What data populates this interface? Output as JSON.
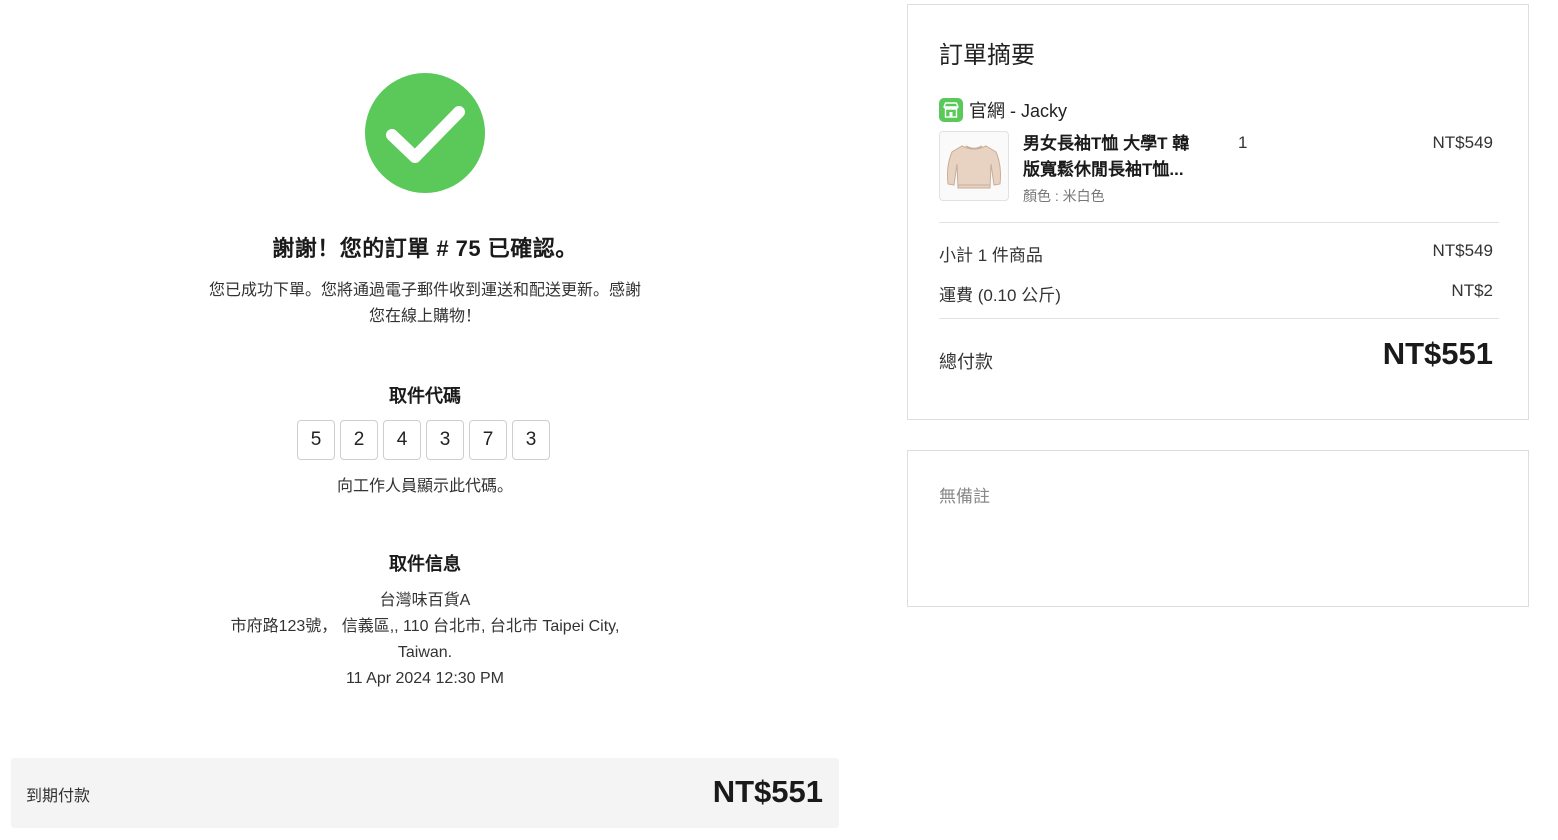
{
  "confirmation": {
    "thanks": "謝謝！您的訂單 # 75 已確認。",
    "message_line1": "您已成功下單。您將通過電子郵件收到運送和配送更新。感謝",
    "message_line2": "您在線上購物！",
    "check_icon": "checkmark-circle-icon",
    "accent_color": "#5ac95a"
  },
  "pickup_code": {
    "title": "取件代碼",
    "digits": [
      "5",
      "2",
      "4",
      "3",
      "7",
      "3"
    ],
    "hint": "向工作人員顯示此代碼。"
  },
  "pickup_info": {
    "title": "取件信息",
    "store_name": "台灣味百貨A",
    "address_line1": "市府路123號， 信義區,, 110 台北市, 台北市 Taipei City,",
    "address_line2": "Taiwan.",
    "datetime": "11 Apr 2024 12:30 PM"
  },
  "due": {
    "label": "到期付款",
    "amount": "NT$551"
  },
  "summary": {
    "title": "訂單摘要",
    "store": "官網 - Jacky",
    "store_icon": "storefront-icon",
    "item": {
      "name_line1": "男女長袖T恤 大學T 韓",
      "name_line2": "版寬鬆休閒長袖T恤...",
      "variant": "顏色 : 米白色",
      "qty": "1",
      "price": "NT$549",
      "thumb_icon": "sweater-product-image"
    },
    "subtotal_label": "小計 1 件商品",
    "subtotal_value": "NT$549",
    "shipping_label": "運費 (0.10 公斤)",
    "shipping_value": "NT$2",
    "total_label": "總付款",
    "total_value": "NT$551"
  },
  "notes": {
    "text": "無備註"
  }
}
